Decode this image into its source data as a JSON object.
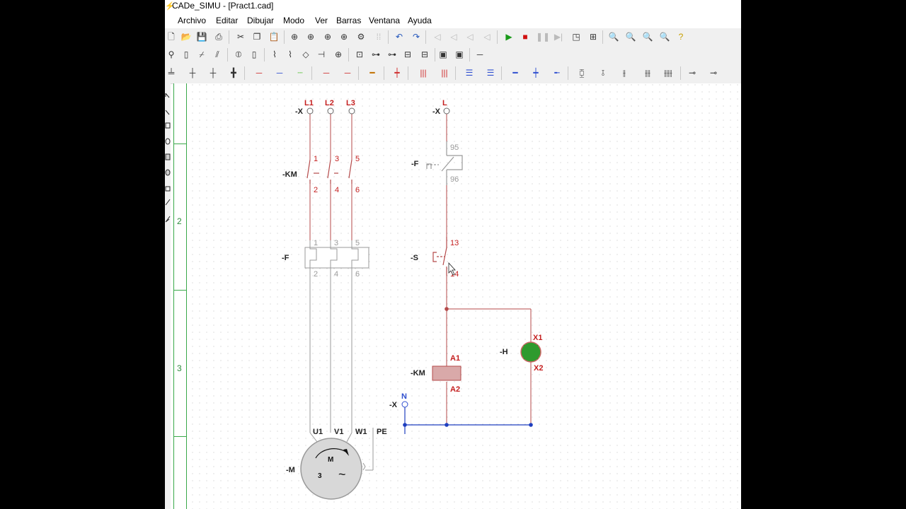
{
  "window": {
    "title": "CADe_SIMU - [Pract1.cad]"
  },
  "menu": {
    "items": [
      {
        "label": "Archivo"
      },
      {
        "label": "Editar"
      },
      {
        "label": "Dibujar"
      },
      {
        "label": "Modo"
      },
      {
        "label": "Ver"
      },
      {
        "label": "Barras"
      },
      {
        "label": "Ventana"
      },
      {
        "label": "Ayuda"
      }
    ]
  },
  "toolbar1": {
    "icons": [
      "new-file-icon",
      "open-folder-icon",
      "save-icon",
      "print-icon",
      "cut-icon",
      "copy-icon",
      "paste-icon",
      "zoom-page-icon",
      "print-preview-icon",
      "find-icon",
      "component-icon",
      "wire-icon",
      "grid-icon",
      "undo-icon",
      "redo-icon",
      "align-left-icon",
      "align-center-icon",
      "align-right-icon",
      "simulate-icon",
      "play-icon",
      "stop-icon",
      "pause-icon",
      "step-icon",
      "view-icon",
      "sheet-icon",
      "zoom-in-icon",
      "zoom-out-icon",
      "zoom-fit-icon",
      "zoom-window-icon",
      "help-icon"
    ]
  },
  "ruler": {
    "numbers": [
      "2",
      "3"
    ]
  },
  "schematic": {
    "power_terminals": {
      "tag": "-X",
      "l1": "L1",
      "l2": "L2",
      "l3": "L3"
    },
    "contactor_power": {
      "tag": "-KM",
      "t1": "1",
      "t3": "3",
      "t5": "5",
      "t2": "2",
      "t4": "4",
      "t6": "6"
    },
    "thermal_relay": {
      "tag": "-F",
      "t1": "1",
      "t3": "3",
      "t5": "5",
      "t2": "2",
      "t4": "4",
      "t6": "6"
    },
    "motor": {
      "tag": "-M",
      "u1": "U1",
      "v1": "V1",
      "w1": "W1",
      "pe": "PE",
      "m": "M",
      "phases": "3",
      "ac": "~"
    },
    "control_terminal_l": {
      "tag": "-X",
      "label": "L"
    },
    "thermal_contact": {
      "tag": "-F",
      "top": "95",
      "bottom": "96"
    },
    "pushbutton": {
      "tag": "-S",
      "top": "13",
      "bottom": "14"
    },
    "coil": {
      "tag": "-KM",
      "top": "A1",
      "bottom": "A2"
    },
    "lamp": {
      "tag": "-H",
      "top": "X1",
      "bottom": "X2",
      "color": "#2e9a2e"
    },
    "control_terminal_n": {
      "tag": "-X",
      "label": "N"
    }
  },
  "colors": {
    "wire_power": "#b54a4a",
    "wire_neutral": "#1f3fbf",
    "label_red": "#c41e1e",
    "component_grey": "#9a9a9a"
  }
}
